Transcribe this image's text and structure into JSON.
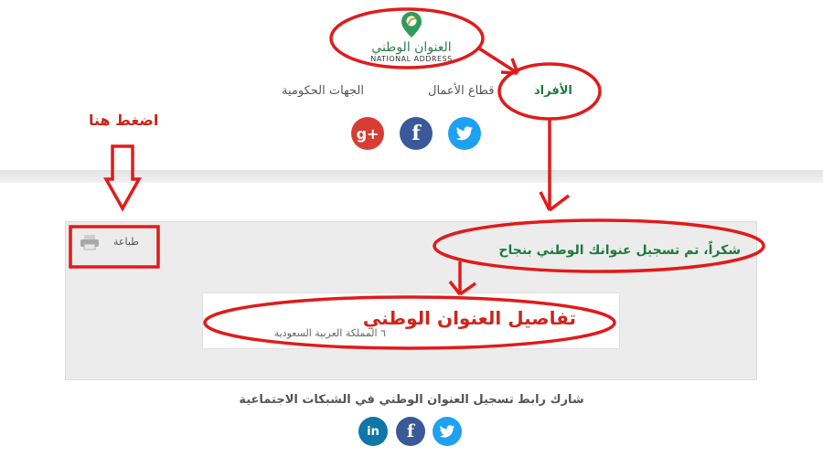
{
  "logo": {
    "arabic": "العنوان الوطني",
    "english": "NATIONAL ADDRESS",
    "brand_color": "#2e7d4f"
  },
  "nav": {
    "individuals": "الأفراد",
    "business": "قطاع الأعمال",
    "government": "الجهات الحكومية"
  },
  "print": {
    "label": "طباعة",
    "icon": "printer-icon"
  },
  "status": {
    "thanks": "شكراً، تم تسجيل عنوانك الوطني بنجاح"
  },
  "details": {
    "title": "تفاصيل العنوان الوطني",
    "country": "٦ المملكة العربية السعودية"
  },
  "share": {
    "text": "شارك رابط تسجيل العنوان الوطني في الشبكات الاجتماعية"
  },
  "annotations": {
    "press_here": "اضغط هنا"
  },
  "social_top": [
    {
      "icon": "google-plus-icon",
      "glyph": "g+",
      "color": "#d73d32"
    },
    {
      "icon": "facebook-icon",
      "glyph": "f",
      "color": "#3b5998"
    },
    {
      "icon": "twitter-icon",
      "color": "#1da1f2"
    }
  ],
  "social_bottom": [
    {
      "icon": "linkedin-icon",
      "glyph": "in",
      "color": "#0e76a8"
    },
    {
      "icon": "facebook-icon",
      "glyph": "f",
      "color": "#3b5998"
    },
    {
      "icon": "twitter-icon",
      "color": "#1da1f2"
    }
  ],
  "colors": {
    "accent_green": "#1c7a3c",
    "annotation_red": "#e01b1b",
    "panel_bg": "#ececec"
  }
}
